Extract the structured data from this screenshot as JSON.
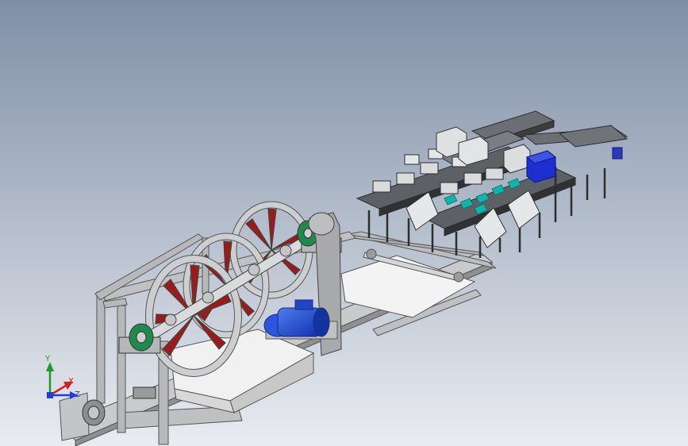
{
  "viewport": {
    "background_top": "#7f8fa6",
    "background_bottom": "#e9ecf1"
  },
  "colors": {
    "frame": "#b9bbbd",
    "frame_dark": "#6f7274",
    "wheel": "#c9cbcd",
    "spoke": "#9b1b1b",
    "shaft": "#d9dadb",
    "bearing": "#1f8a4c",
    "motor": "#1d4ed8",
    "panel": "#f2f2f2",
    "conveyor": "#505357",
    "teal": "#0fb5a8",
    "box_blue": "#1e2fd0"
  },
  "triad": {
    "x_label": "X",
    "y_label": "Y",
    "z_label": "Z",
    "x_color": "#d62020",
    "y_color": "#1e9a2a",
    "z_color": "#1f3fd6"
  }
}
